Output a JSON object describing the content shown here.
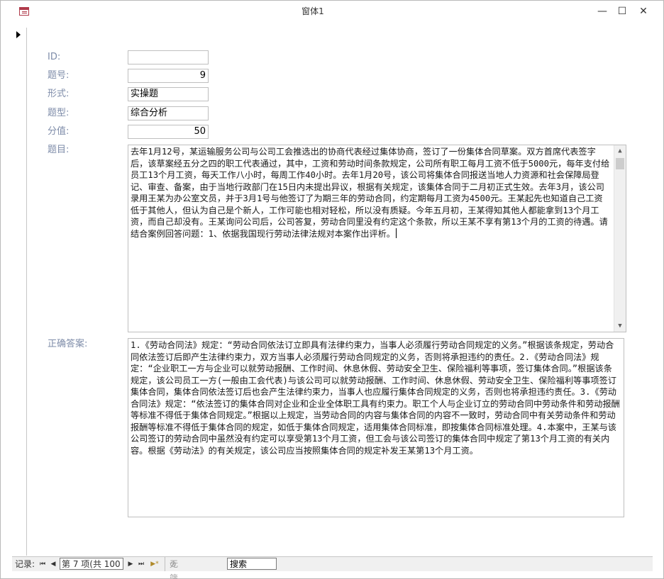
{
  "window": {
    "title": "窗体1",
    "minimize": "—",
    "maximize": "☐",
    "close": "✕"
  },
  "form": {
    "fields": [
      {
        "label": "ID:",
        "value": ""
      },
      {
        "label": "题号:",
        "value": "9"
      },
      {
        "label": "形式:",
        "value": "实操题"
      },
      {
        "label": "题型:",
        "value": "综合分析"
      },
      {
        "label": "分值:",
        "value": "50"
      }
    ],
    "question_label": "题目:",
    "question_text": "去年1月12号，某运输服务公司与公司工会推选出的协商代表经过集体协商，签订了一份集体合同草案。双方首席代表签字后，该草案经五分之四的职工代表通过，其中，工资和劳动时间条款规定，公司所有职工每月工资不低于5000元，每年支付给员工13个月工资，每天工作八小时，每周工作40小时。去年1月20号，该公司将集体合同报送当地人力资源和社会保障局登记、审查、备案，由于当地行政部门在15日内未提出异议，根据有关规定，该集体合同于二月初正式生效。去年3月，该公司录用王某为办公室文员，并于3月1号与他签订了为期三年的劳动合同，约定期每月工资为4500元。王某起先也知道自己工资低于其他人，但认为自己是个新人，工作可能也相对轻松，所以没有质疑。今年五月初，王某得知其他人都能拿到13个月工资，而自己却没有。王某询问公司后，公司答复，劳动合同里没有约定这个条款，所以王某不享有第13个月的工资的待遇。请结合案例回答问题：1、依据我国现行劳动法律法规对本案作出评析。",
    "answer_label": "正确答案:",
    "answer_text": "1.《劳动合同法》规定：“劳动合同依法订立即具有法律约束力，当事人必须履行劳动合同规定的义务。”根据该条规定，劳动合同依法签订后即产生法律约束力，双方当事人必须履行劳动合同规定的义务，否则将承担违约的责任。2.《劳动合同法》规定：“企业职工一方与企业可以就劳动报酬、工作时间、休息休假、劳动安全卫生、保险福利等事项，签订集体合同。”根据该条规定，该公司员工一方(一般由工会代表)与该公司可以就劳动报酬、工作时间、休息休假、劳动安全卫生、保险福利等事项签订集体合同，集体合同依法签订后也会产生法律约束力，当事人也应履行集体合同规定的义务，否则也将承担违约责任。3.《劳动合同法》规定：“依法签订的集体合同对企业和企业全体职工具有约束力。职工个人与企业订立的劳动合同中劳动条件和劳动报酬等标准不得低于集体合同规定。”根据以上规定，当劳动合同的内容与集体合同的内容不一致时，劳动合同中有关劳动条件和劳动报酬等标准不得低于集体合同的规定，如低于集体合同规定，适用集体合同标准，即按集体合同标准处理。4.本案中，王某与该公司签订的劳动合同中虽然没有约定可以享受第13个月工资，但工会与该公司签订的集体合同中规定了第13个月工资的有关内容。根据《劳动法》的有关规定，该公司应当按照集体合同的规定补发王某第13个月工资。"
  },
  "navigation": {
    "record_label": "记录:",
    "first": "⏮",
    "prev": "◀",
    "position": "第 7 项(共 100 项)",
    "next": "▶",
    "last": "⏭",
    "new": "▶*",
    "filter": "无筛选器",
    "search": "搜索"
  }
}
